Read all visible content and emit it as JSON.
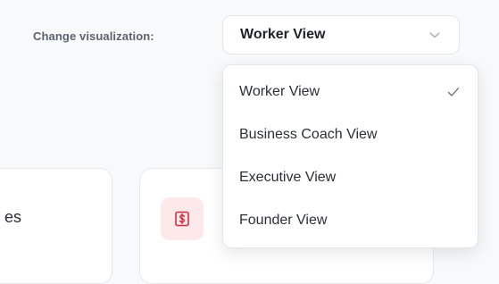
{
  "visualization": {
    "label": "Change visualization:",
    "selected": "Worker View",
    "options": [
      {
        "label": "Worker View",
        "selected": true
      },
      {
        "label": "Business Coach View",
        "selected": false
      },
      {
        "label": "Executive View",
        "selected": false
      },
      {
        "label": "Founder View",
        "selected": false
      }
    ]
  },
  "cards": {
    "left_partial_text": "es"
  },
  "icons": {
    "select_chevron": "chevron-down-icon",
    "check": "check-icon",
    "money": "dollar-sign-icon"
  },
  "colors": {
    "text_primary": "#1f2328",
    "label_gray": "#5b6270",
    "money_icon": "#d92d3a",
    "money_badge_bg": "#fde8ea"
  }
}
